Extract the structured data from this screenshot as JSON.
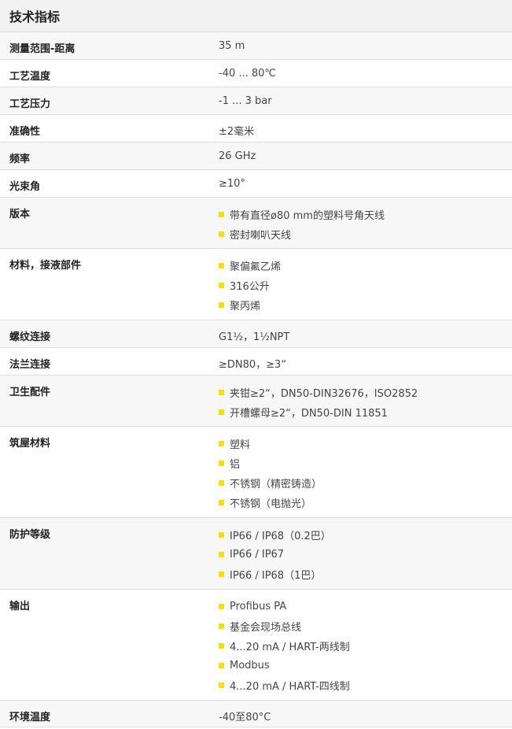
{
  "header": {
    "title": "技术指标"
  },
  "rows": [
    {
      "label": "测量范围-距离",
      "value": "35 m"
    },
    {
      "label": "工艺温度",
      "value": "-40 ... 80℃"
    },
    {
      "label": "工艺压力",
      "value": "-1 ... 3 bar"
    },
    {
      "label": "准确性",
      "value": "±2毫米"
    },
    {
      "label": "频率",
      "value": "26 GHz"
    },
    {
      "label": "光束角",
      "value": "≥10°"
    },
    {
      "label": "版本",
      "items": [
        "带有直径ø80 mm的塑料号角天线",
        "密封喇叭天线"
      ]
    },
    {
      "label": "材料，接液部件",
      "items": [
        "聚偏氟乙烯",
        "316公升",
        "聚丙烯"
      ]
    },
    {
      "label": "螺纹连接",
      "value": "G1½，1½NPT"
    },
    {
      "label": "法兰连接",
      "value": "≥DN80，≥3“"
    },
    {
      "label": "卫生配件",
      "items": [
        "夹钳≥2“，DN50-DIN32676，ISO2852",
        "开槽螺母≥2“，DN50-DIN 11851"
      ]
    },
    {
      "label": "筑屋材料",
      "items": [
        "塑料",
        "铝",
        "不锈钢（精密铸造）",
        "不锈钢（电抛光）"
      ]
    },
    {
      "label": "防护等级",
      "items": [
        "IP66 / IP68（0.2巴）",
        "IP66 / IP67",
        "IP66 / IP68（1巴）"
      ]
    },
    {
      "label": "输出",
      "items": [
        "Profibus PA",
        "基金会现场总线",
        "4...20 mA / HART-两线制",
        "Modbus",
        "4...20 mA / HART-四线制"
      ]
    },
    {
      "label": "环境温度",
      "value": "-40至80°C"
    }
  ],
  "colors": {
    "bullet": "#f5e000",
    "alt_row": "#f7f7f7",
    "header_bg": "#f2f2f2",
    "border": "#dcdcdc"
  }
}
